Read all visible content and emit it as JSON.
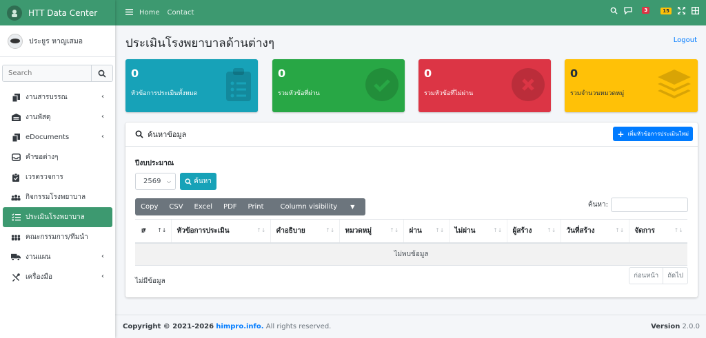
{
  "brand": {
    "title": "HTT Data Center"
  },
  "user": {
    "name": "ประยูร หาญเสมอ"
  },
  "sidebar": {
    "search_placeholder": "Search",
    "items": [
      {
        "label": "งานสารบรรณ",
        "icon": "copy-icon",
        "has_submenu": true
      },
      {
        "label": "งานพัสดุ",
        "icon": "warehouse-icon",
        "has_submenu": true
      },
      {
        "label": "eDocuments",
        "icon": "copy-icon",
        "has_submenu": true
      },
      {
        "label": "คำขอต่างๆ",
        "icon": "inbox-icon",
        "has_submenu": false
      },
      {
        "label": "เวรตรวจการ",
        "icon": "clipboard-check-icon",
        "has_submenu": false
      },
      {
        "label": "กิจกรรมโรงพยาบาล",
        "icon": "users-icon",
        "has_submenu": false
      },
      {
        "label": "ประเมินโรงพยาบาล",
        "icon": "tasks-icon",
        "has_submenu": false,
        "active": true
      },
      {
        "label": "คณะกรรมการ/ทีมนำ",
        "icon": "people-group-icon",
        "has_submenu": false
      },
      {
        "label": "งานแผน",
        "icon": "truck-icon",
        "has_submenu": true
      },
      {
        "label": "เครื่องมือ",
        "icon": "tools-icon",
        "has_submenu": true
      }
    ]
  },
  "topbar": {
    "links": [
      "Home",
      "Contact"
    ],
    "notification_count": "3",
    "alert_count": "15"
  },
  "page": {
    "title": "ประเมินโรงพยาบาลด้านต่างๆ",
    "logout": "Logout"
  },
  "stats": [
    {
      "value": "0",
      "label": "หัวข้อการประเมินทั้งหมด",
      "icon": "clipboard-list-icon",
      "color": "#17a2b8"
    },
    {
      "value": "0",
      "label": "รวมหัวข้อที่ผ่าน",
      "icon": "check-circle-icon",
      "color": "#28a745"
    },
    {
      "value": "0",
      "label": "รวมหัวข้อที่ไม่ผ่าน",
      "icon": "times-circle-icon",
      "color": "#dc3545"
    },
    {
      "value": "0",
      "label": "รวมจำนวนหมวดหมู่",
      "icon": "layer-group-icon",
      "color": "#ffc107"
    }
  ],
  "search_card": {
    "title": "ค้นหาข้อมูล",
    "add_button": "เพิ่มหัวข้อการประเมินใหม่",
    "fiscal_year_label": "ปีงบประมาณ",
    "fiscal_year_value": "2569",
    "search_button": "ค้นหา"
  },
  "datatable": {
    "buttons": [
      "Copy",
      "CSV",
      "Excel",
      "PDF",
      "Print",
      "Column visibility"
    ],
    "filter_label": "ค้นหา:",
    "columns": [
      "#",
      "หัวข้อการประเมิน",
      "คำอธิบาย",
      "หมวดหมู่",
      "ผ่าน",
      "ไม่ผ่าน",
      "ผู้สร้าง",
      "วันที่สร้าง",
      "จัดการ"
    ],
    "empty_message": "ไม่พบข้อมูล",
    "info": "ไม่มีข้อมูล",
    "pager": [
      "ก่อนหน้า",
      "ถัดไป"
    ]
  },
  "footer": {
    "copyright": "Copyright © 2021-2026",
    "site": "himpro.info.",
    "rights": "All rights reserved.",
    "version_label": "Version",
    "version": "2.0.0"
  },
  "colors": {
    "primary_green": "#3d9970",
    "link_blue": "#007bff"
  }
}
